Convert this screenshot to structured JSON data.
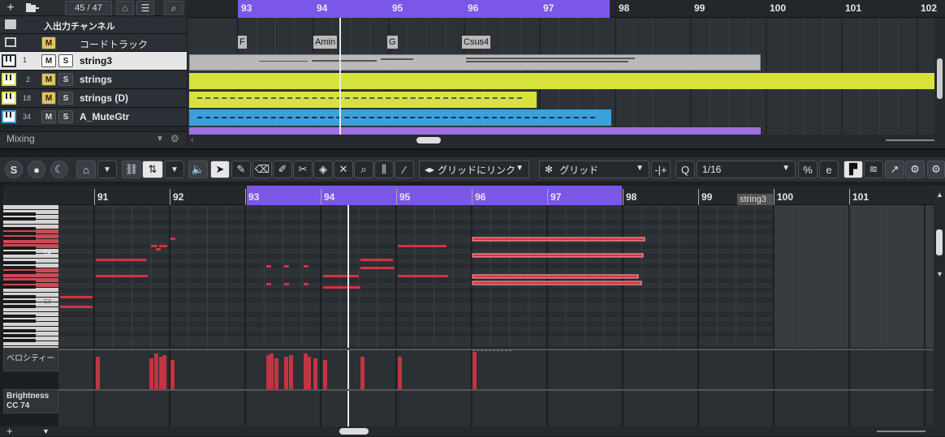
{
  "top": {
    "counter": "45 / 47",
    "io_channel": "入出力チャンネル",
    "chord_track": "コードトラック",
    "mixing_label": "Mixing",
    "bars": [
      "93",
      "94",
      "95",
      "96",
      "97",
      "98",
      "99",
      "100",
      "101",
      "102"
    ],
    "chords": [
      "F",
      "Amin",
      "G",
      "Csus4"
    ],
    "tracks": [
      {
        "num": "1",
        "name": "string3",
        "color": "#cfcfcf"
      },
      {
        "num": "2",
        "name": "strings",
        "color": "#d7e23c"
      },
      {
        "num": "18",
        "name": "strings (D)",
        "color": "#d7e23c"
      },
      {
        "num": "34",
        "name": "A_MuteGtr",
        "color": "#3aa0d9"
      }
    ],
    "m": "M",
    "s": "S"
  },
  "editor": {
    "link_label": "グリッドにリンク",
    "grid_label": "グリッド",
    "quantize_value": "1/16",
    "q": "Q",
    "bars": [
      "91",
      "92",
      "93",
      "94",
      "95",
      "96",
      "97",
      "98",
      "99",
      "100",
      "101"
    ],
    "part_label": "string3",
    "c4": "C4",
    "c3": "C3",
    "velocity_label": "ベロシティー",
    "cc_label_1": "Brightness",
    "cc_label_2": "CC 74"
  },
  "colors": {
    "accent": "#7b57e8",
    "note": "#d6323f",
    "yellow": "#d7e23c",
    "blue": "#3aa0d9"
  }
}
